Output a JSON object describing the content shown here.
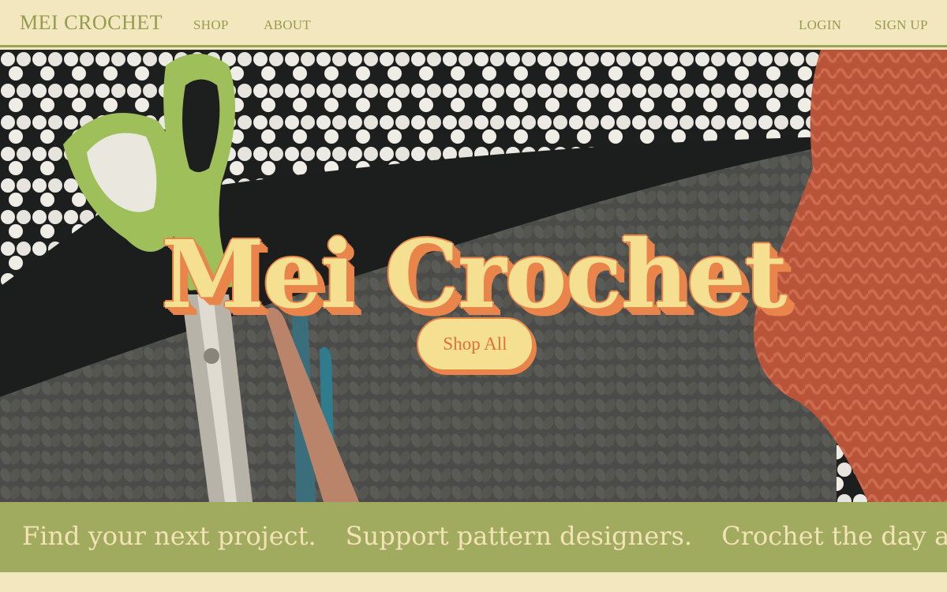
{
  "nav": {
    "brand": "MEI CROCHET",
    "links": [
      {
        "label": "SHOP"
      },
      {
        "label": "ABOUT"
      }
    ],
    "account": [
      {
        "label": "LOGIN"
      },
      {
        "label": "SIGN UP"
      }
    ]
  },
  "hero": {
    "title": "Mei Crochet",
    "cta_label": "Shop All",
    "photo_description_icons": [
      "scissors-icon",
      "crochet-hook-icon",
      "yarn-skein-icon"
    ]
  },
  "marquee": {
    "phrases": [
      "Find your next project.",
      "Support pattern designers.",
      "Crochet the day away."
    ]
  },
  "colors": {
    "cream": "#f3e7bf",
    "olive": "#a1ab5f",
    "nav_text": "#949c4e",
    "title_fill": "#f5df91",
    "title_shadow": "#e9854a",
    "cta_text": "#e2703b"
  }
}
